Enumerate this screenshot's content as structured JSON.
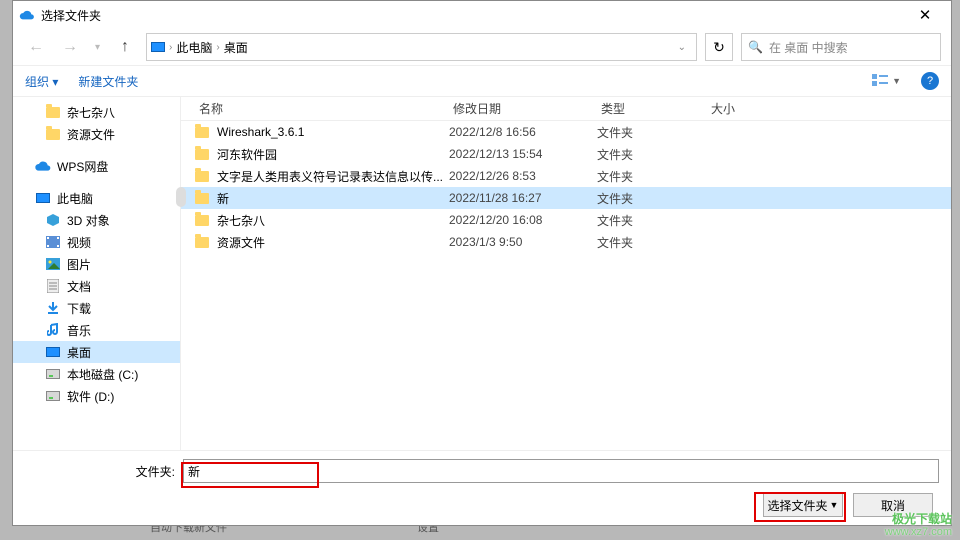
{
  "window": {
    "title": "选择文件夹"
  },
  "path": {
    "root": "此电脑",
    "current": "桌面"
  },
  "search": {
    "placeholder": "在 桌面 中搜索"
  },
  "toolbar": {
    "organize": "组织",
    "new_folder": "新建文件夹"
  },
  "sidebar": {
    "items": [
      {
        "label": "杂七杂八",
        "kind": "folder",
        "level": 2,
        "selected": false
      },
      {
        "label": "资源文件",
        "kind": "folder",
        "level": 2,
        "selected": false
      },
      {
        "label": "WPS网盘",
        "kind": "cloud",
        "level": 1,
        "selected": false
      },
      {
        "label": "此电脑",
        "kind": "pc",
        "level": 1,
        "selected": false
      },
      {
        "label": "3D 对象",
        "kind": "3d",
        "level": 2,
        "selected": false
      },
      {
        "label": "视频",
        "kind": "video",
        "level": 2,
        "selected": false
      },
      {
        "label": "图片",
        "kind": "image",
        "level": 2,
        "selected": false
      },
      {
        "label": "文档",
        "kind": "doc",
        "level": 2,
        "selected": false
      },
      {
        "label": "下载",
        "kind": "download",
        "level": 2,
        "selected": false
      },
      {
        "label": "音乐",
        "kind": "music",
        "level": 2,
        "selected": false
      },
      {
        "label": "桌面",
        "kind": "desktop",
        "level": 2,
        "selected": true
      },
      {
        "label": "本地磁盘 (C:)",
        "kind": "drive",
        "level": 2,
        "selected": false
      },
      {
        "label": "软件 (D:)",
        "kind": "drive",
        "level": 2,
        "selected": false
      }
    ]
  },
  "columns": {
    "name": "名称",
    "date": "修改日期",
    "type": "类型",
    "size": "大小"
  },
  "rows": [
    {
      "name": "Wireshark_3.6.1",
      "date": "2022/12/8 16:56",
      "type": "文件夹",
      "selected": false
    },
    {
      "name": "河东软件园",
      "date": "2022/12/13 15:54",
      "type": "文件夹",
      "selected": false
    },
    {
      "name": "文字是人类用表义符号记录表达信息以传...",
      "date": "2022/12/26 8:53",
      "type": "文件夹",
      "selected": false
    },
    {
      "name": "新",
      "date": "2022/11/28 16:27",
      "type": "文件夹",
      "selected": true
    },
    {
      "name": "杂七杂八",
      "date": "2022/12/20 16:08",
      "type": "文件夹",
      "selected": false
    },
    {
      "name": "资源文件",
      "date": "2023/1/3 9:50",
      "type": "文件夹",
      "selected": false
    }
  ],
  "footer": {
    "label": "文件夹:",
    "value": "新",
    "select_btn": "选择文件夹",
    "cancel_btn": "取消"
  },
  "bgstrip": {
    "a": "自动下载新文件",
    "b": "设置"
  },
  "watermark": {
    "line1": "极光下载站",
    "line2": "www.xz7.com"
  }
}
